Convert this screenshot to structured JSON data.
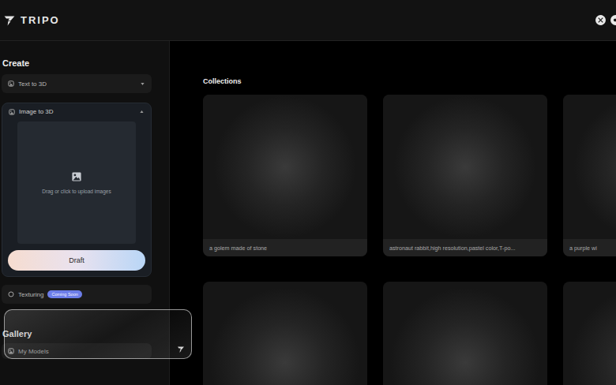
{
  "header": {
    "logo": "TRIPO"
  },
  "sidebar": {
    "title": "Create",
    "modes": [
      {
        "label": "Text to 3D",
        "expanded": false
      },
      {
        "label": "Image to 3D",
        "expanded": true
      }
    ],
    "upload": {
      "hint": "Drag or click to upload images"
    },
    "primary_button": "Draft",
    "texturing": {
      "label": "Texturing",
      "badge": "Coming Soon"
    },
    "gallery": {
      "title": "Gallery",
      "items": [
        "My Models"
      ]
    }
  },
  "collections": {
    "title": "Collections",
    "cards": [
      {
        "caption": "a golem made of stone"
      },
      {
        "caption": "astronaut rabbit,high resolution,pastel color,T-po..."
      },
      {
        "caption": "a purple wi"
      },
      {},
      {},
      {}
    ]
  }
}
